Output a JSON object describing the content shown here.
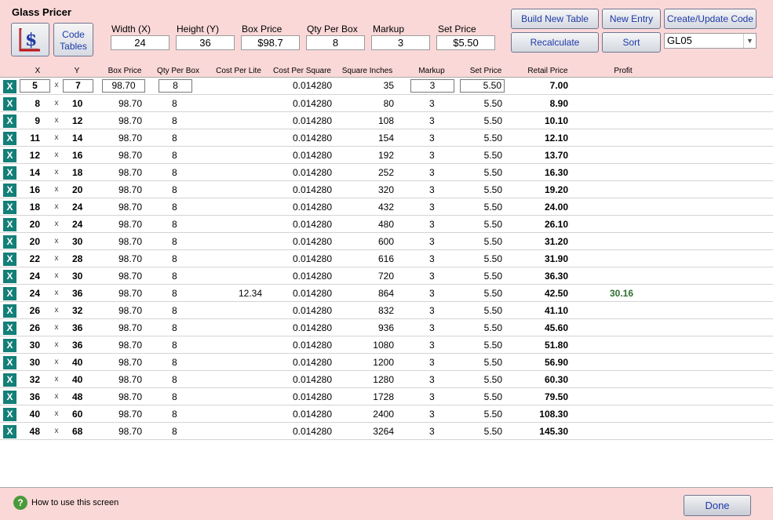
{
  "app": {
    "title": "Glass Pricer"
  },
  "toolbar": {
    "code_tables_label_1": "Code",
    "code_tables_label_2": "Tables",
    "fields": {
      "width": {
        "label": "Width (X)",
        "value": "24"
      },
      "height": {
        "label": "Height (Y)",
        "value": "36"
      },
      "box_price": {
        "label": "Box Price",
        "value": "$98.7"
      },
      "qty_per_box": {
        "label": "Qty Per Box",
        "value": "8"
      },
      "markup": {
        "label": "Markup",
        "value": "3"
      },
      "set_price": {
        "label": "Set Price",
        "value": "$5.50"
      }
    },
    "buttons": {
      "build_new_table": "Build New Table",
      "new_entry": "New Entry",
      "create_update_code": "Create/Update Code",
      "recalculate": "Recalculate",
      "sort": "Sort"
    },
    "code_select": "GL05"
  },
  "table": {
    "headers": {
      "x": "X",
      "y": "Y",
      "box_price": "Box Price",
      "qty_per_box": "Qty Per Box",
      "cost_per_lite": "Cost Per Lite",
      "cost_per_square": "Cost Per Square",
      "square_inches": "Square Inches",
      "markup": "Markup",
      "set_price": "Set Price",
      "retail_price": "Retail Price",
      "profit": "Profit"
    },
    "delete_label": "X",
    "times_sign": "x",
    "rows": [
      {
        "x": "5",
        "y": "7",
        "box_price": "98.70",
        "qty": "8",
        "cost_per_lite": "",
        "cost_per_square": "0.014280",
        "sq_in": "35",
        "markup": "3",
        "set_price": "5.50",
        "retail": "7.00",
        "profit": ""
      },
      {
        "x": "8",
        "y": "10",
        "box_price": "98.70",
        "qty": "8",
        "cost_per_lite": "",
        "cost_per_square": "0.014280",
        "sq_in": "80",
        "markup": "3",
        "set_price": "5.50",
        "retail": "8.90",
        "profit": ""
      },
      {
        "x": "9",
        "y": "12",
        "box_price": "98.70",
        "qty": "8",
        "cost_per_lite": "",
        "cost_per_square": "0.014280",
        "sq_in": "108",
        "markup": "3",
        "set_price": "5.50",
        "retail": "10.10",
        "profit": ""
      },
      {
        "x": "11",
        "y": "14",
        "box_price": "98.70",
        "qty": "8",
        "cost_per_lite": "",
        "cost_per_square": "0.014280",
        "sq_in": "154",
        "markup": "3",
        "set_price": "5.50",
        "retail": "12.10",
        "profit": ""
      },
      {
        "x": "12",
        "y": "16",
        "box_price": "98.70",
        "qty": "8",
        "cost_per_lite": "",
        "cost_per_square": "0.014280",
        "sq_in": "192",
        "markup": "3",
        "set_price": "5.50",
        "retail": "13.70",
        "profit": ""
      },
      {
        "x": "14",
        "y": "18",
        "box_price": "98.70",
        "qty": "8",
        "cost_per_lite": "",
        "cost_per_square": "0.014280",
        "sq_in": "252",
        "markup": "3",
        "set_price": "5.50",
        "retail": "16.30",
        "profit": ""
      },
      {
        "x": "16",
        "y": "20",
        "box_price": "98.70",
        "qty": "8",
        "cost_per_lite": "",
        "cost_per_square": "0.014280",
        "sq_in": "320",
        "markup": "3",
        "set_price": "5.50",
        "retail": "19.20",
        "profit": ""
      },
      {
        "x": "18",
        "y": "24",
        "box_price": "98.70",
        "qty": "8",
        "cost_per_lite": "",
        "cost_per_square": "0.014280",
        "sq_in": "432",
        "markup": "3",
        "set_price": "5.50",
        "retail": "24.00",
        "profit": ""
      },
      {
        "x": "20",
        "y": "24",
        "box_price": "98.70",
        "qty": "8",
        "cost_per_lite": "",
        "cost_per_square": "0.014280",
        "sq_in": "480",
        "markup": "3",
        "set_price": "5.50",
        "retail": "26.10",
        "profit": ""
      },
      {
        "x": "20",
        "y": "30",
        "box_price": "98.70",
        "qty": "8",
        "cost_per_lite": "",
        "cost_per_square": "0.014280",
        "sq_in": "600",
        "markup": "3",
        "set_price": "5.50",
        "retail": "31.20",
        "profit": ""
      },
      {
        "x": "22",
        "y": "28",
        "box_price": "98.70",
        "qty": "8",
        "cost_per_lite": "",
        "cost_per_square": "0.014280",
        "sq_in": "616",
        "markup": "3",
        "set_price": "5.50",
        "retail": "31.90",
        "profit": ""
      },
      {
        "x": "24",
        "y": "30",
        "box_price": "98.70",
        "qty": "8",
        "cost_per_lite": "",
        "cost_per_square": "0.014280",
        "sq_in": "720",
        "markup": "3",
        "set_price": "5.50",
        "retail": "36.30",
        "profit": ""
      },
      {
        "x": "24",
        "y": "36",
        "box_price": "98.70",
        "qty": "8",
        "cost_per_lite": "12.34",
        "cost_per_square": "0.014280",
        "sq_in": "864",
        "markup": "3",
        "set_price": "5.50",
        "retail": "42.50",
        "profit": "30.16"
      },
      {
        "x": "26",
        "y": "32",
        "box_price": "98.70",
        "qty": "8",
        "cost_per_lite": "",
        "cost_per_square": "0.014280",
        "sq_in": "832",
        "markup": "3",
        "set_price": "5.50",
        "retail": "41.10",
        "profit": ""
      },
      {
        "x": "26",
        "y": "36",
        "box_price": "98.70",
        "qty": "8",
        "cost_per_lite": "",
        "cost_per_square": "0.014280",
        "sq_in": "936",
        "markup": "3",
        "set_price": "5.50",
        "retail": "45.60",
        "profit": ""
      },
      {
        "x": "30",
        "y": "36",
        "box_price": "98.70",
        "qty": "8",
        "cost_per_lite": "",
        "cost_per_square": "0.014280",
        "sq_in": "1080",
        "markup": "3",
        "set_price": "5.50",
        "retail": "51.80",
        "profit": ""
      },
      {
        "x": "30",
        "y": "40",
        "box_price": "98.70",
        "qty": "8",
        "cost_per_lite": "",
        "cost_per_square": "0.014280",
        "sq_in": "1200",
        "markup": "3",
        "set_price": "5.50",
        "retail": "56.90",
        "profit": ""
      },
      {
        "x": "32",
        "y": "40",
        "box_price": "98.70",
        "qty": "8",
        "cost_per_lite": "",
        "cost_per_square": "0.014280",
        "sq_in": "1280",
        "markup": "3",
        "set_price": "5.50",
        "retail": "60.30",
        "profit": ""
      },
      {
        "x": "36",
        "y": "48",
        "box_price": "98.70",
        "qty": "8",
        "cost_per_lite": "",
        "cost_per_square": "0.014280",
        "sq_in": "1728",
        "markup": "3",
        "set_price": "5.50",
        "retail": "79.50",
        "profit": ""
      },
      {
        "x": "40",
        "y": "60",
        "box_price": "98.70",
        "qty": "8",
        "cost_per_lite": "",
        "cost_per_square": "0.014280",
        "sq_in": "2400",
        "markup": "3",
        "set_price": "5.50",
        "retail": "108.30",
        "profit": ""
      },
      {
        "x": "48",
        "y": "68",
        "box_price": "98.70",
        "qty": "8",
        "cost_per_lite": "",
        "cost_per_square": "0.014280",
        "sq_in": "3264",
        "markup": "3",
        "set_price": "5.50",
        "retail": "145.30",
        "profit": ""
      }
    ]
  },
  "footer": {
    "help_icon_glyph": "?",
    "help_link": "How to use this screen",
    "done_label": "Done"
  }
}
